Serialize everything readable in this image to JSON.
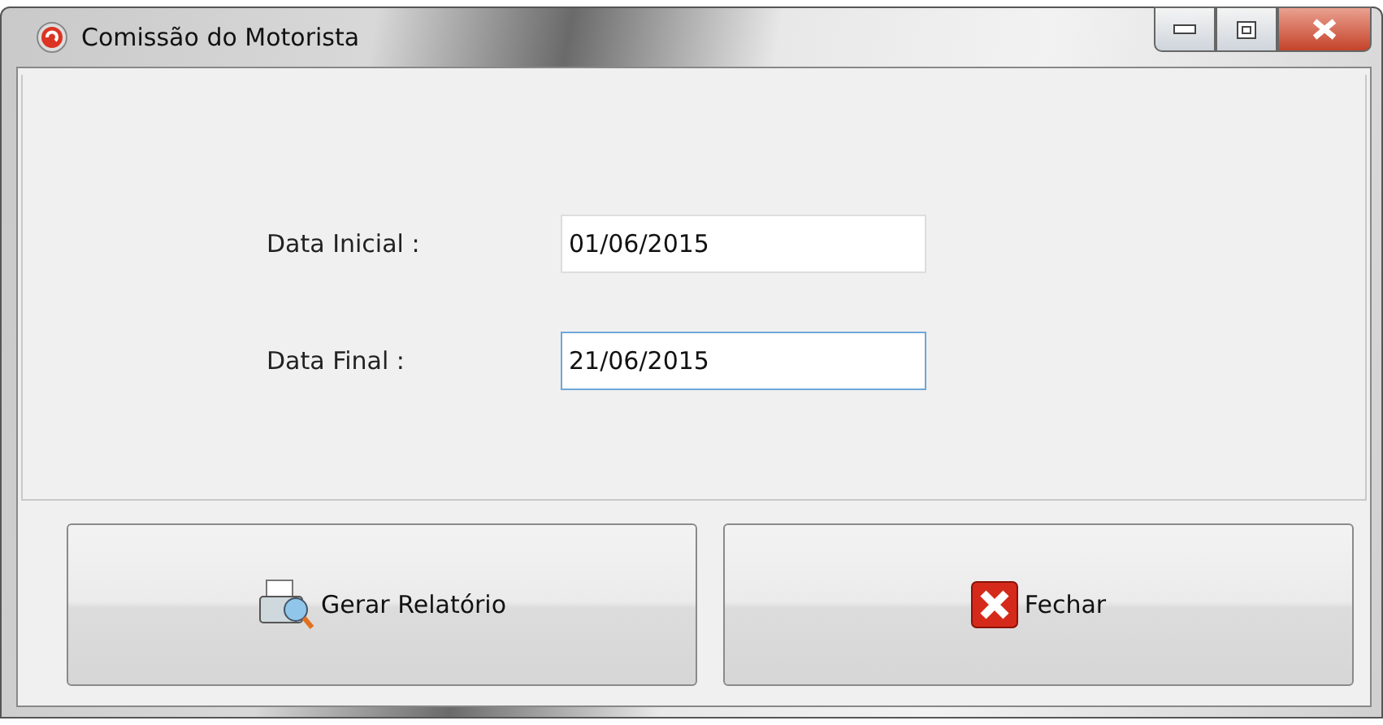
{
  "window": {
    "title": "Comissão do Motorista"
  },
  "fields": [
    {
      "label": "Data Inicial :",
      "value": "01/06/2015",
      "focused": false
    },
    {
      "label": "Data Final :",
      "value": "21/06/2015",
      "focused": true
    }
  ],
  "buttons": [
    {
      "label": "Gerar Relatório",
      "kind": "report"
    },
    {
      "label": "Fechar",
      "kind": "close"
    }
  ]
}
